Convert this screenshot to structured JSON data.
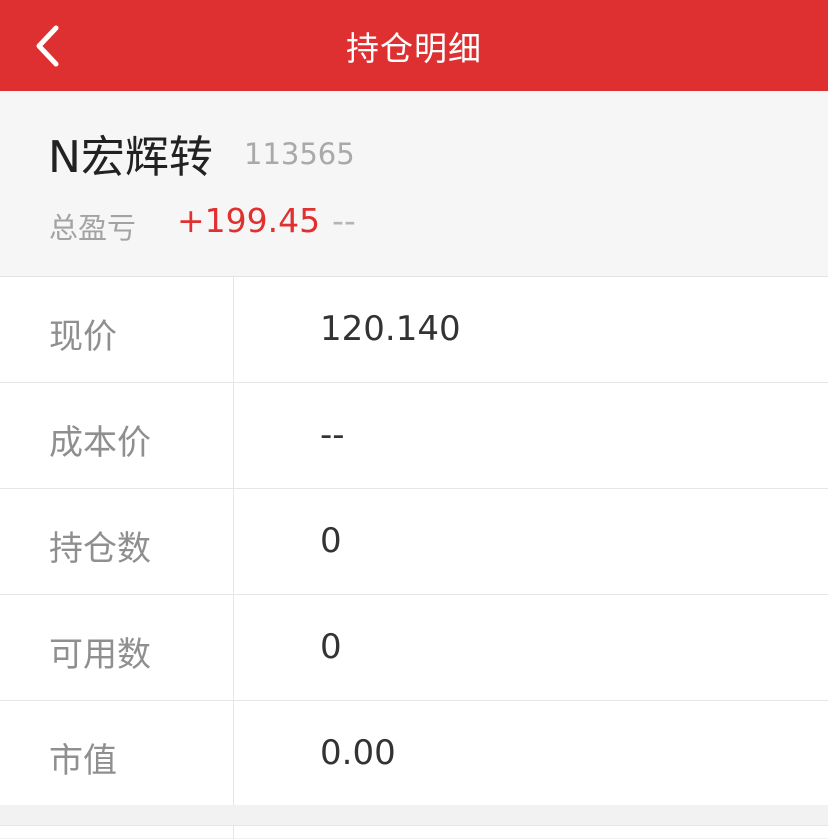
{
  "header": {
    "title": "持仓明细",
    "back_icon": "chevron-left-icon",
    "bg_color": "#df3031"
  },
  "stock": {
    "name": "N宏辉转",
    "code": "113565",
    "total_pl_label": "总盈亏",
    "total_pl_value": "+199.45",
    "total_pl_ratio": "--",
    "pl_color": "#e0302f"
  },
  "details": [
    {
      "label": "现价",
      "value": "120.140"
    },
    {
      "label": "成本价",
      "value": "--"
    },
    {
      "label": "持仓数",
      "value": "0"
    },
    {
      "label": "可用数",
      "value": "0"
    },
    {
      "label": "市值",
      "value": "0.00"
    }
  ]
}
